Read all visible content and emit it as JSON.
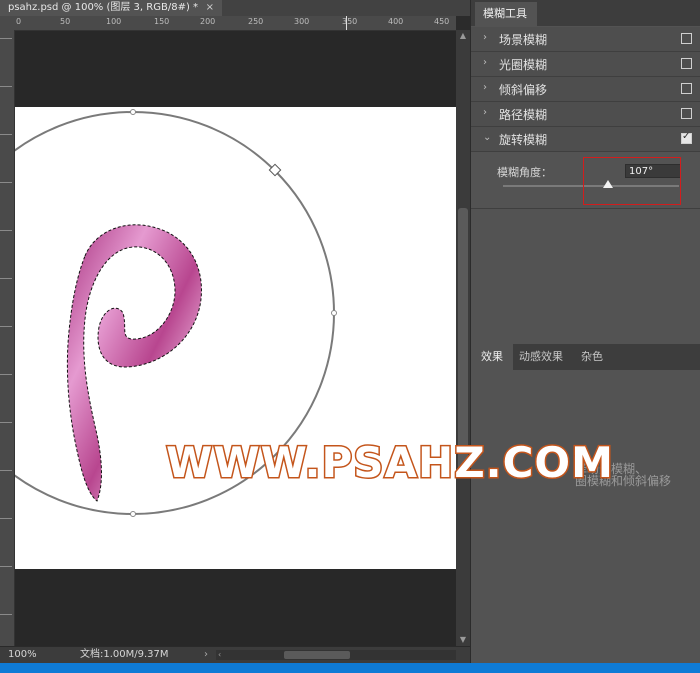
{
  "document": {
    "tab_title": "psahz.psd @ 100% (图层 3, RGB/8#) *",
    "close_symbol": "×",
    "zoom": "100%",
    "doc_size": "文档:1.00M/9.37M",
    "status_arrow": "›",
    "ruler_top_labels": [
      "0",
      "50",
      "100",
      "150",
      "200",
      "250",
      "300",
      "350",
      "400",
      "450"
    ]
  },
  "blur_panel": {
    "tab": "模糊工具",
    "items": [
      {
        "label": "场景模糊",
        "checked": false,
        "expanded": false
      },
      {
        "label": "光圈模糊",
        "checked": false,
        "expanded": false
      },
      {
        "label": "倾斜偏移",
        "checked": false,
        "expanded": false
      },
      {
        "label": "路径模糊",
        "checked": false,
        "expanded": false
      },
      {
        "label": "旋转模糊",
        "checked": true,
        "expanded": true
      }
    ],
    "chevron_collapsed": "›",
    "chevron_expanded": "⌄",
    "angle_label": "模糊角度：",
    "angle_value": "107°",
    "angle_fraction": 0.595
  },
  "effects_panel": {
    "tabs": [
      "效果",
      "动感效果",
      "杂色"
    ],
    "hint_line1": "择场景模糊、",
    "hint_line2": "圈模糊和倾斜偏移"
  },
  "watermark": "WWW.PSAHZ.COM",
  "colors": {
    "accent_red": "#d21d1d",
    "letter_pink": "#c45aa2",
    "watermark_stroke": "#c4551b"
  }
}
